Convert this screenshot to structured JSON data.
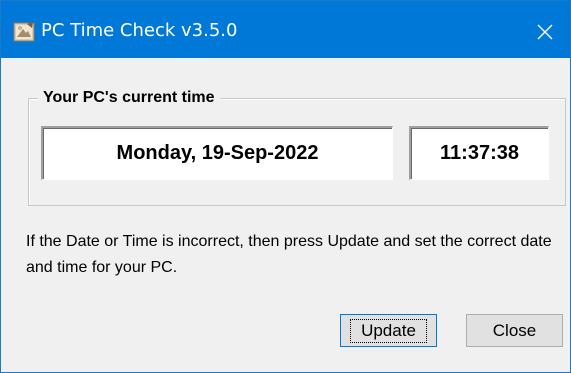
{
  "window": {
    "title": "PC Time Check  v3.5.0",
    "app_icon": "paintbrush-app-icon",
    "close_icon": "close-icon",
    "colors": {
      "titlebar": "#0078d7",
      "window_bg": "#f0f0f0"
    }
  },
  "group": {
    "legend": "Your PC's current time",
    "date_value": "Monday, 19-Sep-2022",
    "time_value": "11:37:38"
  },
  "message": "If the Date or Time is incorrect, then press Update and set the correct date and time for your PC.",
  "buttons": {
    "update_label": "Update",
    "close_label": "Close"
  }
}
